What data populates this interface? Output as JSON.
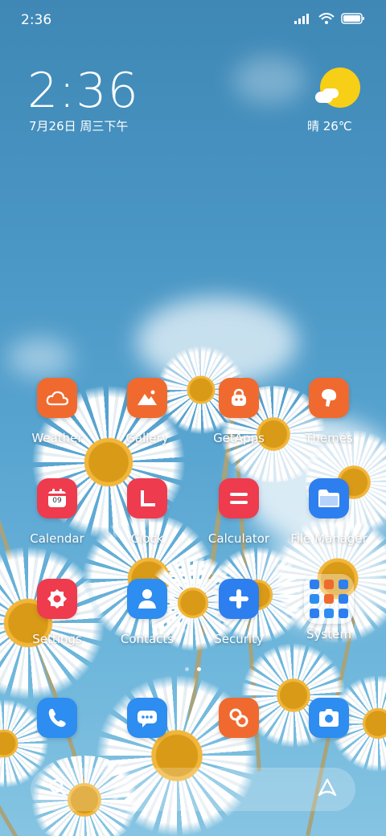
{
  "status_bar": {
    "time": "2:36",
    "icons": [
      "signal-icon",
      "wifi-icon",
      "battery-icon"
    ]
  },
  "clock_widget": {
    "time": "2:36",
    "date": "7月26日 周三下午"
  },
  "weather_widget": {
    "text": "晴 26℃",
    "icon": "sun-cloud-icon"
  },
  "apps": [
    {
      "label": "Weather",
      "color": "#f06a2f",
      "icon": "cloud-icon"
    },
    {
      "label": "Gallery",
      "color": "#f06a2f",
      "icon": "mountain-icon"
    },
    {
      "label": "GetApps",
      "color": "#f06a2f",
      "icon": "bag-icon"
    },
    {
      "label": "Themes",
      "color": "#f06a2f",
      "icon": "brush-icon"
    },
    {
      "label": "Calendar",
      "color": "#ee3b4e",
      "icon": "calendar-icon",
      "badge": "09"
    },
    {
      "label": "Clock",
      "color": "#ee3b4e",
      "icon": "clock-icon"
    },
    {
      "label": "Calculator",
      "color": "#ee3b4e",
      "icon": "equals-icon"
    },
    {
      "label": "File Manager",
      "color": "#2d7ff0",
      "icon": "folder-icon"
    },
    {
      "label": "Settings",
      "color": "#ee3b4e",
      "icon": "gear-icon"
    },
    {
      "label": "Contacts",
      "color": "#2d8df0",
      "icon": "person-icon"
    },
    {
      "label": "Security",
      "color": "#2d7ff0",
      "icon": "plus-shield-icon"
    },
    {
      "label": "System",
      "color": "folder",
      "icon": "folder-group-icon"
    }
  ],
  "dock": [
    {
      "name": "phone",
      "color": "#2d8df0",
      "icon": "phone-icon"
    },
    {
      "name": "messages",
      "color": "#2d8df0",
      "icon": "chat-icon"
    },
    {
      "name": "browser",
      "color": "#f06a2f",
      "icon": "browser-icon"
    },
    {
      "name": "camera",
      "color": "#2d8df0",
      "icon": "camera-icon"
    }
  ],
  "page_indicator": {
    "count": 2,
    "active": 2
  },
  "search_bar": {
    "left_icon": "search-icon",
    "right_icon": "assistant-icon"
  }
}
